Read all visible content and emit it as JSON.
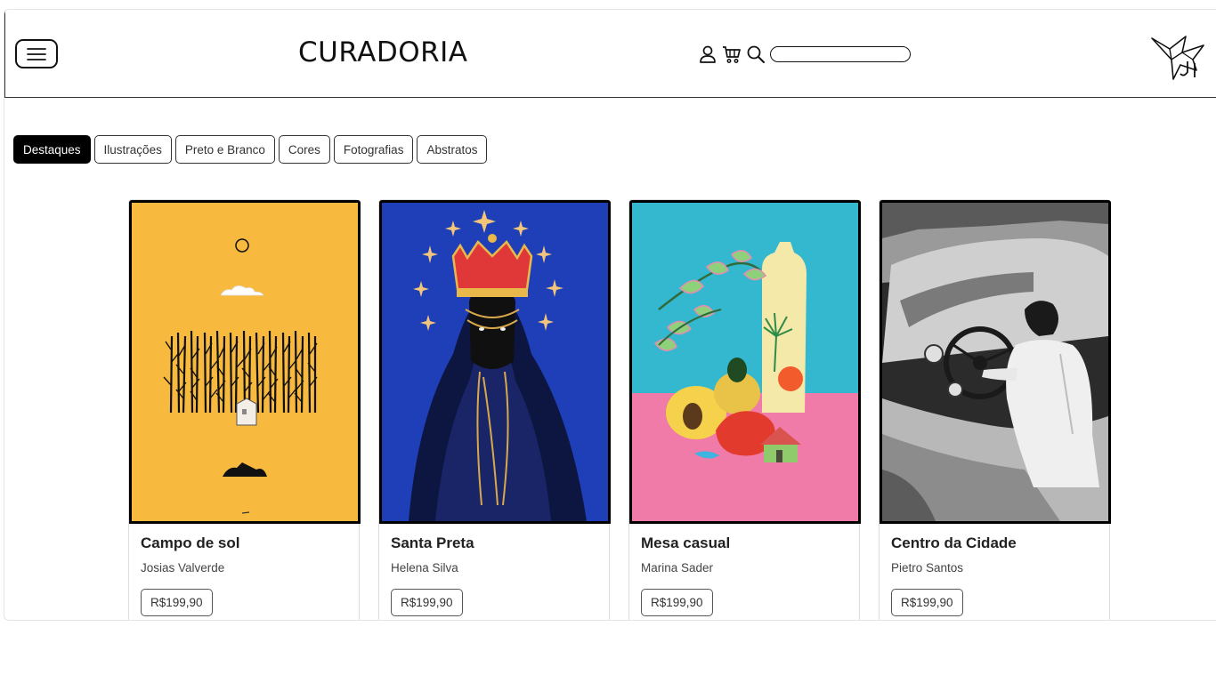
{
  "header": {
    "brand": "CURADORIA",
    "search_placeholder": "",
    "icons": [
      "menu-icon",
      "user-icon",
      "cart-icon",
      "search-icon",
      "origami-bird-logo"
    ]
  },
  "filters": [
    {
      "label": "Destaques",
      "active": true
    },
    {
      "label": "Ilustrações",
      "active": false
    },
    {
      "label": "Preto e Branco",
      "active": false
    },
    {
      "label": "Cores",
      "active": false
    },
    {
      "label": "Fotografias",
      "active": false
    },
    {
      "label": "Abstratos",
      "active": false
    }
  ],
  "products": [
    {
      "title": "Campo de sol",
      "artist": "Josias Valverde",
      "price": "R$199,90"
    },
    {
      "title": "Santa Preta",
      "artist": "Helena Silva",
      "price": "R$199,90"
    },
    {
      "title": "Mesa casual",
      "artist": "Marina Sader",
      "price": "R$199,90"
    },
    {
      "title": "Centro da Cidade",
      "artist": "Pietro Santos",
      "price": "R$199,90"
    }
  ],
  "colors": {
    "accent": "#000000",
    "art_yellow": "#F7B93E",
    "art_blue": "#1F3FB8",
    "art_teal": "#34B8CF",
    "art_pink": "#F07BA8"
  }
}
